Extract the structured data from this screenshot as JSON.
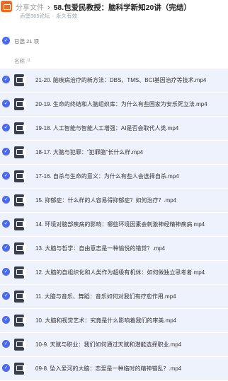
{
  "header": {
    "breadcrumb_share": "分享文件",
    "separator": "›",
    "title": "58.包爱民教授：脑科学新知20讲（完结）",
    "source": "赤堡365论坛",
    "dot": "·",
    "validity": "永久有效"
  },
  "selection": {
    "label": "已选 21 项"
  },
  "list": {
    "column_name": "名称",
    "files": [
      {
        "name": "21-20. 脑疾病治疗的新方法：DBS、TMS、BCI基因治疗等技术.mp4"
      },
      {
        "name": "20-19. 生命的终结和人脑组织库：为什么有些国家为安乐死立法.mp4"
      },
      {
        "name": "19-18. 人工智能与智能人工增强：AI是否会取代人类.mp4"
      },
      {
        "name": "18-17. 大脑与犯罪：“犯罪脑”长什么样.mp4"
      },
      {
        "name": "17-16. 自杀与生命的意义：为什么有些人会选择自杀.mp4"
      },
      {
        "name": "15. 抑郁症：什么样的人容易得抑郁症？如何治疗？.mp4"
      },
      {
        "name": "14. 环境对脑部疾病的影响：哪些环境因素会刺激神经精神疾病.mp4"
      },
      {
        "name": "13. 大脑与哲学：自由意志是一种愉悦的错觉？.mp4"
      },
      {
        "name": "12. 大脑的自组织化和人类作为超级有机体：如何做独立思考者.mp4"
      },
      {
        "name": "11. 大脑与音乐、舞蹈：音乐如何对我们有疗愈作用.mp4"
      },
      {
        "name": "10. 大脑和视觉艺术：究竟是什么影响着我们的审美.mp4"
      },
      {
        "name": "10-9. 天赋与职业：我们如何通过天赋和潜能选择职业.mp4"
      },
      {
        "name": "09-8. 坠入爱河的大脑：恋爱是一种临时的精神错乱？.mp4"
      }
    ]
  },
  "colors": {
    "accent": "#4a69f0",
    "row_bg": "#eef2fd",
    "app_icon": "#f06a1e"
  }
}
